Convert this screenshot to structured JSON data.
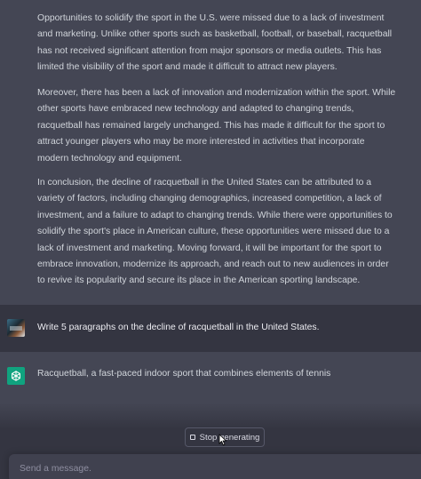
{
  "conversation": {
    "assistant_paragraphs": [
      "Opportunities to solidify the sport in the U.S. were missed due to a lack of investment and marketing. Unlike other sports such as basketball, football, or baseball, racquetball has not received significant attention from major sponsors or media outlets. This has limited the visibility of the sport and made it difficult to attract new players.",
      "Moreover, there has been a lack of innovation and modernization within the sport. While other sports have embraced new technology and adapted to changing trends, racquetball has remained largely unchanged. This has made it difficult for the sport to attract younger players who may be more interested in activities that incorporate modern technology and equipment.",
      "In conclusion, the decline of racquetball in the United States can be attributed to a variety of factors, including changing demographics, increased competition, a lack of investment, and a failure to adapt to changing trends. While there were opportunities to solidify the sport's place in American culture, these opportunities were missed due to a lack of investment and marketing. Moving forward, it will be important for the sport to embrace innovation, modernize its approach, and reach out to new audiences in order to revive its popularity and secure its place in the American sporting landscape."
    ],
    "user_message": "Write 5 paragraphs on the decline of racquetball in the United States.",
    "assistant_reply_partial": "Racquetball, a fast-paced indoor sport that combines elements of tennis"
  },
  "controls": {
    "stop_label": "Stop generating",
    "input_placeholder": "Send a message."
  },
  "icons": {
    "user_avatar": "avatar-image",
    "assistant_avatar": "openai-logo-icon",
    "stop": "stop-square-icon",
    "cursor": "mouse-pointer-icon"
  },
  "colors": {
    "assistant_bg": "#444654",
    "user_bg": "#343541",
    "brand_green": "#10a37f",
    "text": "#d1d5db"
  }
}
